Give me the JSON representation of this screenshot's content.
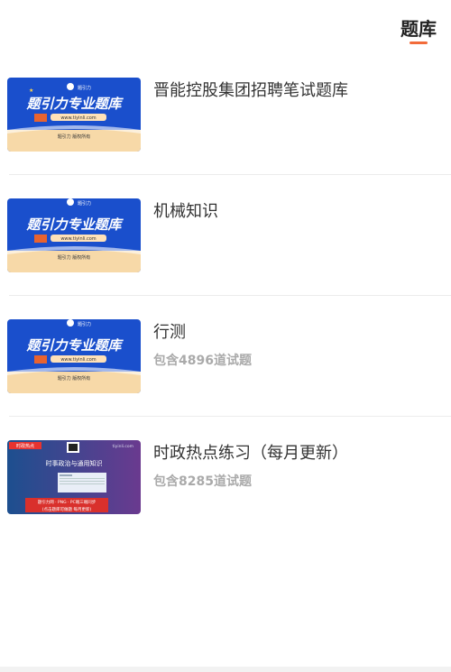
{
  "header": {
    "tab_label": "题库"
  },
  "thumb_brand": {
    "title": "题引力专业题库",
    "url": "www.tiyinli.com",
    "tagline_1": "题引力 版权所有",
    "tagline_2": "题引力 版权所有",
    "tagline_3": "题引力 版权所有",
    "logo_text": "题引力"
  },
  "thumb_news": {
    "tag": "时政热点",
    "title": "时事政治与通用知识",
    "site": "tiyinli.com",
    "line1": "题引力网 · PNG · PC端三端同步",
    "line2": "(点击题库可做题 每月更新)"
  },
  "items": [
    {
      "title": "晋能控股集团招聘笔试题库",
      "subtitle": ""
    },
    {
      "title": "机械知识",
      "subtitle": ""
    },
    {
      "title": "行测",
      "subtitle": "包含4896道试题"
    },
    {
      "title": "时政热点练习（每月更新）",
      "subtitle": "包含8285道试题"
    }
  ],
  "colors": {
    "accent": "#f26b3a",
    "brand_blue": "#1a4fcc",
    "banner_orange": "#f5a85c"
  }
}
